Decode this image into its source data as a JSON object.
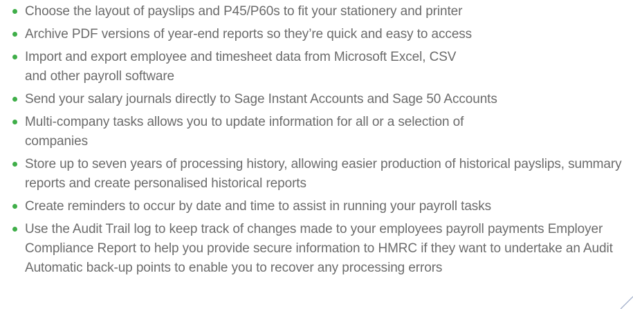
{
  "features": [
    "Choose the layout of payslips and P45/P60s to fit your stationery and printer",
    "Archive PDF versions of year-end reports so they’re quick and easy to access",
    "Import and export employee and timesheet data from Microsoft Excel, CSV and other payroll software",
    "Send your salary journals directly to Sage Instant Accounts and Sage 50 Accounts",
    "Multi-company tasks allows you to update information for all or a selection of companies",
    "Store up to seven years of processing history, allowing easier production of historical payslips, summary reports and create personalised historical reports",
    "Create reminders to occur by date and time to assist in running your payroll tasks",
    "Use the Audit Trail log to keep track of changes made to your employees payroll payments Employer Compliance Report to help you provide secure information to HMRC if they want to undertake an Audit Automatic back-up points to enable you to recover any processing errors"
  ],
  "colors": {
    "text": "#6b6b6b",
    "bullet": "#3fae49",
    "accent_line": "#9aa8c6"
  }
}
